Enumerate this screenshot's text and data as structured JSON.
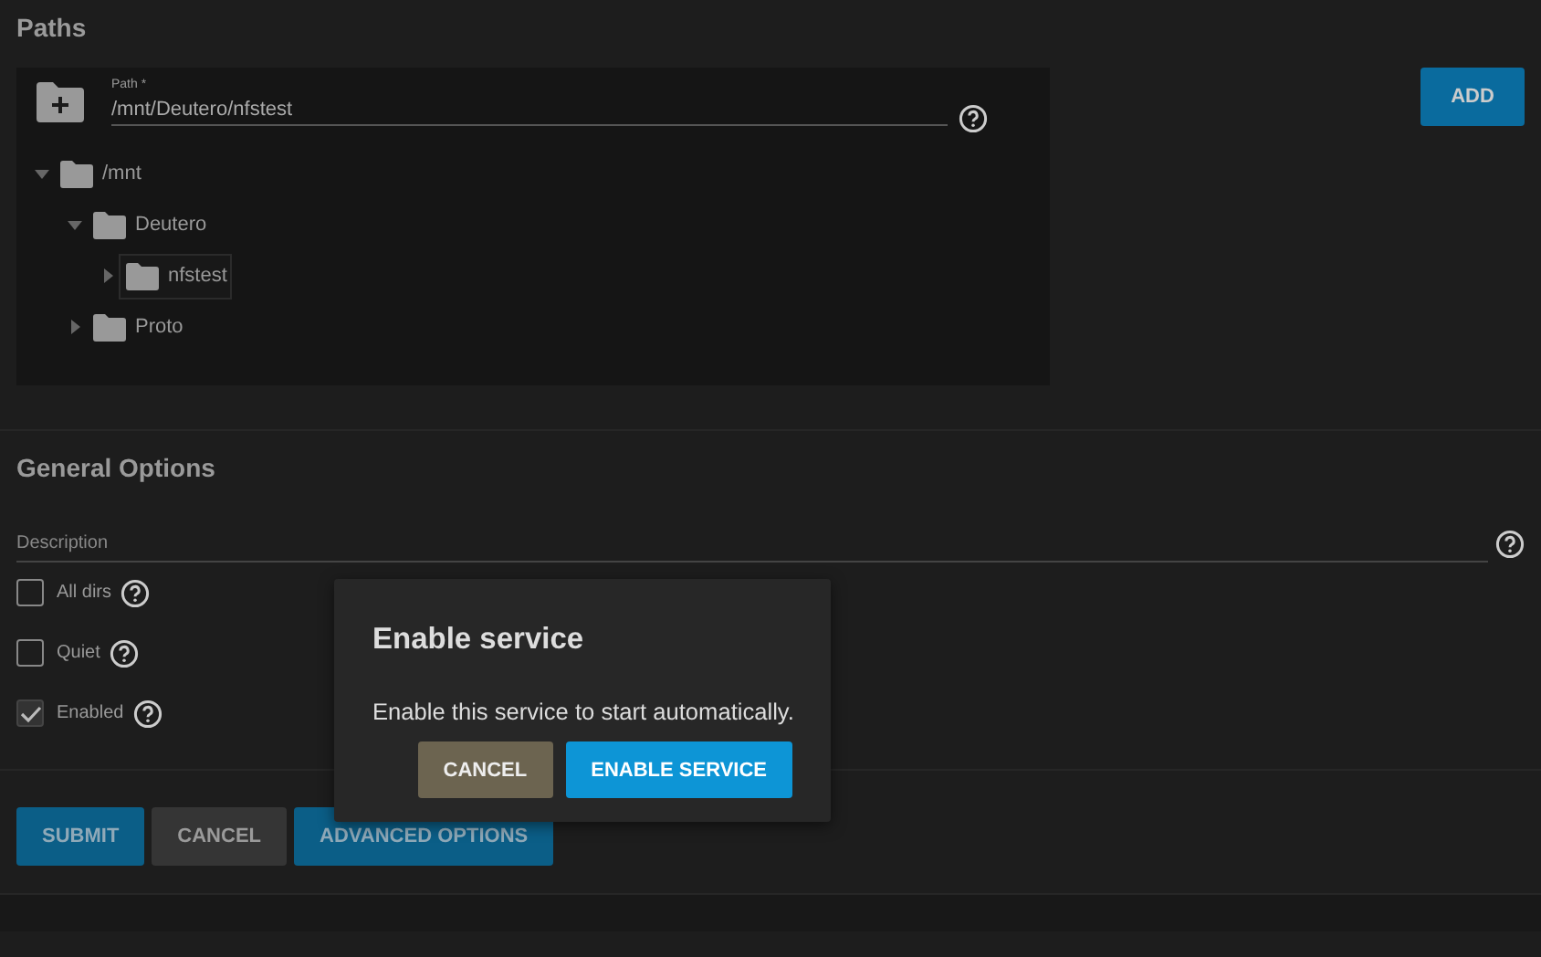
{
  "paths": {
    "title": "Paths",
    "path_field": {
      "label": "Path *",
      "value": "/mnt/Deutero/nfstest"
    },
    "add_button": "ADD",
    "tree": [
      {
        "label": "/mnt",
        "expanded": true,
        "selected": false,
        "children": [
          {
            "label": "Deutero",
            "expanded": true,
            "selected": false,
            "children": [
              {
                "label": "nfstest",
                "expanded": false,
                "selected": true
              }
            ]
          },
          {
            "label": "Proto",
            "expanded": false,
            "selected": false
          }
        ]
      }
    ]
  },
  "general_options": {
    "title": "General Options",
    "description_field": {
      "placeholder": "Description"
    },
    "checkboxes": [
      {
        "label": "All dirs",
        "checked": false
      },
      {
        "label": "Quiet",
        "checked": false
      },
      {
        "label": "Enabled",
        "checked": true
      }
    ]
  },
  "buttons": [
    {
      "label": "SUBMIT",
      "kind": "primary"
    },
    {
      "label": "CANCEL",
      "kind": "secondary"
    },
    {
      "label": "ADVANCED OPTIONS",
      "kind": "primary"
    }
  ],
  "dialog": {
    "title": "Enable service",
    "message": "Enable this service to start automatically.",
    "buttons": [
      {
        "label": "CANCEL",
        "kind": "secondary"
      },
      {
        "label": "ENABLE SERVICE",
        "kind": "primary"
      }
    ]
  }
}
